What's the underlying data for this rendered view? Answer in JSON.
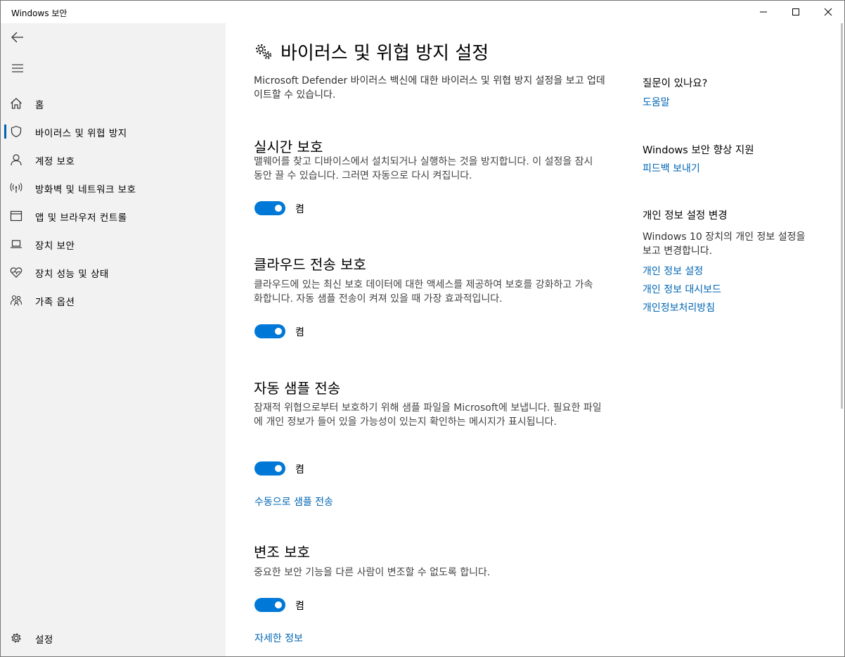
{
  "window": {
    "title": "Windows 보안"
  },
  "sidebar": {
    "items": [
      {
        "label": "홈",
        "icon": "home-icon"
      },
      {
        "label": "바이러스 및 위협 방지",
        "icon": "shield-icon"
      },
      {
        "label": "계정 보호",
        "icon": "person-icon"
      },
      {
        "label": "방화벽 및 네트워크 보호",
        "icon": "wifi-antenna-icon"
      },
      {
        "label": "앱 및 브라우저 컨트롤",
        "icon": "browser-window-icon"
      },
      {
        "label": "장치 보안",
        "icon": "laptop-icon"
      },
      {
        "label": "장치 성능 및 상태",
        "icon": "heart-pulse-icon"
      },
      {
        "label": "가족 옵션",
        "icon": "family-icon"
      }
    ],
    "settings_label": "설정"
  },
  "main": {
    "title": "바이러스 및 위협 방지 설정",
    "intro": "Microsoft Defender 바이러스 백신에 대한 바이러스 및 위협 방지 설정을 보고 업데이트할 수 있습니다.",
    "sections": [
      {
        "title": "실시간 보호",
        "description": "맬웨어를 찾고 디바이스에서 설치되거나 실행하는 것을 방지합니다. 이 설정을 잠시 동안 끌 수 있습니다. 그러면 자동으로 다시 켜집니다.",
        "toggle_label": "켬"
      },
      {
        "title": "클라우드 전송 보호",
        "description": "클라우드에 있는 최신 보호 데이터에 대한 액세스를 제공하여 보호를 강화하고 가속화합니다. 자동 샘플 전송이 켜져 있을 때 가장 효과적입니다.",
        "toggle_label": "켬"
      },
      {
        "title": "자동 샘플 전송",
        "description": "잠재적 위협으로부터 보호하기 위해 샘플 파일을 Microsoft에 보냅니다. 필요한 파일에 개인 정보가 들어 있을 가능성이 있는지 확인하는 메시지가 표시됩니다.",
        "toggle_label": "켬",
        "link": "수동으로 샘플 전송"
      },
      {
        "title": "변조 보호",
        "description": "중요한 보안 기능을 다른 사람이 변조할 수 없도록 합니다.",
        "toggle_label": "켬",
        "link": "자세한 정보"
      }
    ]
  },
  "right_panel": {
    "question_title": "질문이 있나요?",
    "help_link": "도움말",
    "improve_title": "Windows 보안 향상 지원",
    "feedback_link": "피드백 보내기",
    "privacy_title": "개인 정보 설정 변경",
    "privacy_text": "Windows 10 장치의 개인 정보 설정을 보고 변경합니다.",
    "privacy_links": [
      "개인 정보 설정",
      "개인 정보 대시보드",
      "개인정보처리방침"
    ]
  },
  "colors": {
    "accent": "#0078d7",
    "link": "#0066b4",
    "sidebar_bg": "#f2f2f2"
  }
}
